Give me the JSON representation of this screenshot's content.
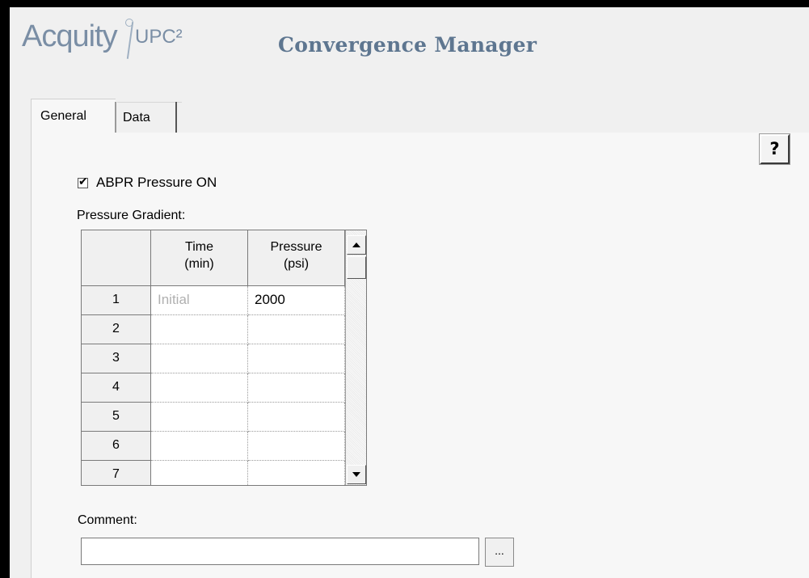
{
  "header": {
    "logo_acquity": "Acquity",
    "logo_upc": "UPC²",
    "title": "Convergence Manager"
  },
  "tabs": [
    {
      "label": "General",
      "selected": true
    },
    {
      "label": "Data",
      "selected": false
    }
  ],
  "help": {
    "label": "?"
  },
  "abpr": {
    "label": "ABPR Pressure ON",
    "checked": true,
    "check_glyph": "✔"
  },
  "gradient": {
    "label": "Pressure Gradient:",
    "columns": {
      "time_line1": "Time",
      "time_line2": "(min)",
      "pressure_line1": "Pressure",
      "pressure_line2": "(psi)"
    },
    "rows": [
      {
        "num": "1",
        "time": "Initial",
        "pressure": "2000"
      },
      {
        "num": "2",
        "time": "",
        "pressure": ""
      },
      {
        "num": "3",
        "time": "",
        "pressure": ""
      },
      {
        "num": "4",
        "time": "",
        "pressure": ""
      },
      {
        "num": "5",
        "time": "",
        "pressure": ""
      },
      {
        "num": "6",
        "time": "",
        "pressure": ""
      },
      {
        "num": "7",
        "time": "",
        "pressure": ""
      }
    ]
  },
  "comment": {
    "label": "Comment:",
    "value": "",
    "browse_label": "..."
  },
  "icons": {
    "help": "question-mark-icon",
    "scroll_up": "triangle-up-icon",
    "scroll_down": "triangle-down-icon",
    "check": "checkmark-icon"
  },
  "colors": {
    "logo": "#7a8ea5",
    "title": "#5e7690",
    "background": "#f0f0f0",
    "frame": "#000000"
  }
}
